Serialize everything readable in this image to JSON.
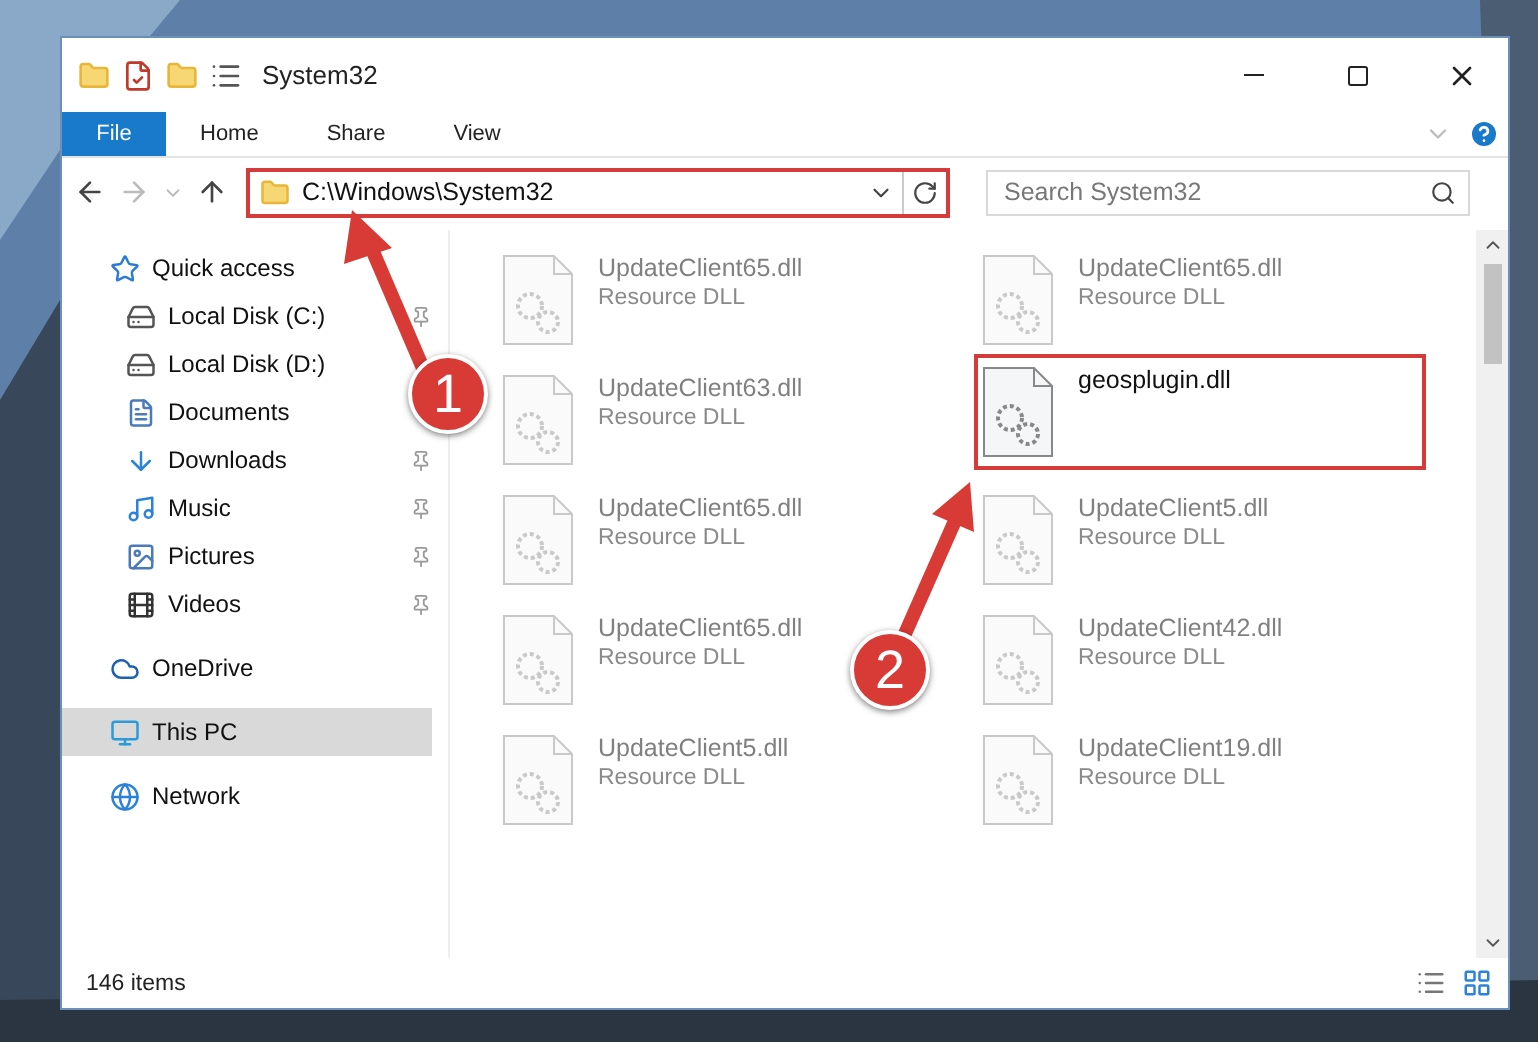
{
  "window": {
    "title": "System32"
  },
  "ribbon_tabs": [
    {
      "label": "File",
      "kind": "file"
    },
    {
      "label": "Home",
      "kind": "tab"
    },
    {
      "label": "Share",
      "kind": "tab"
    },
    {
      "label": "View",
      "kind": "tab"
    }
  ],
  "address_bar": {
    "path": "C:\\Windows\\System32",
    "annotated": true
  },
  "search": {
    "placeholder": "Search System32"
  },
  "sidebar": {
    "items": [
      {
        "label": "Quick access",
        "children": [
          {
            "label": "Local Disk (C:)",
            "pinned": true
          },
          {
            "label": "Local Disk (D:)",
            "pinned": false
          },
          {
            "label": "Documents",
            "pinned": false
          },
          {
            "label": "Downloads",
            "pinned": true
          },
          {
            "label": "Music",
            "pinned": true
          },
          {
            "label": "Pictures",
            "pinned": true
          },
          {
            "label": "Videos",
            "pinned": true
          }
        ],
        "selected": false
      },
      {
        "label": "OneDrive",
        "selected": false
      },
      {
        "label": "This PC",
        "selected": true
      },
      {
        "label": "Network",
        "selected": false
      }
    ]
  },
  "files": [
    {
      "name": "UpdateClient65.dll",
      "type": "Resource DLL",
      "blurred": true,
      "annotated": false
    },
    {
      "name": "UpdateClient65.dll",
      "type": "Resource DLL",
      "blurred": true,
      "annotated": false
    },
    {
      "name": "UpdateClient63.dll",
      "type": "Resource DLL",
      "blurred": true,
      "annotated": false
    },
    {
      "name": "geosplugin.dll",
      "blurred": false,
      "annotated": true
    },
    {
      "name": "UpdateClient65.dll",
      "type": "Resource DLL",
      "blurred": true,
      "annotated": false
    },
    {
      "name": "UpdateClient5.dll",
      "type": "Resource DLL",
      "blurred": true,
      "annotated": false
    },
    {
      "name": "UpdateClient65.dll",
      "type": "Resource DLL",
      "blurred": true,
      "annotated": false
    },
    {
      "name": "UpdateClient42.dll",
      "type": "Resource DLL",
      "blurred": true,
      "annotated": false
    },
    {
      "name": "UpdateClient5.dll",
      "type": "Resource DLL",
      "blurred": true,
      "annotated": false
    },
    {
      "name": "UpdateClient19.dll",
      "type": "Resource DLL",
      "blurred": true,
      "annotated": false
    }
  ],
  "status_bar": {
    "item_count": "146 items"
  },
  "annotations": [
    {
      "label": "1"
    },
    {
      "label": "2"
    }
  ]
}
